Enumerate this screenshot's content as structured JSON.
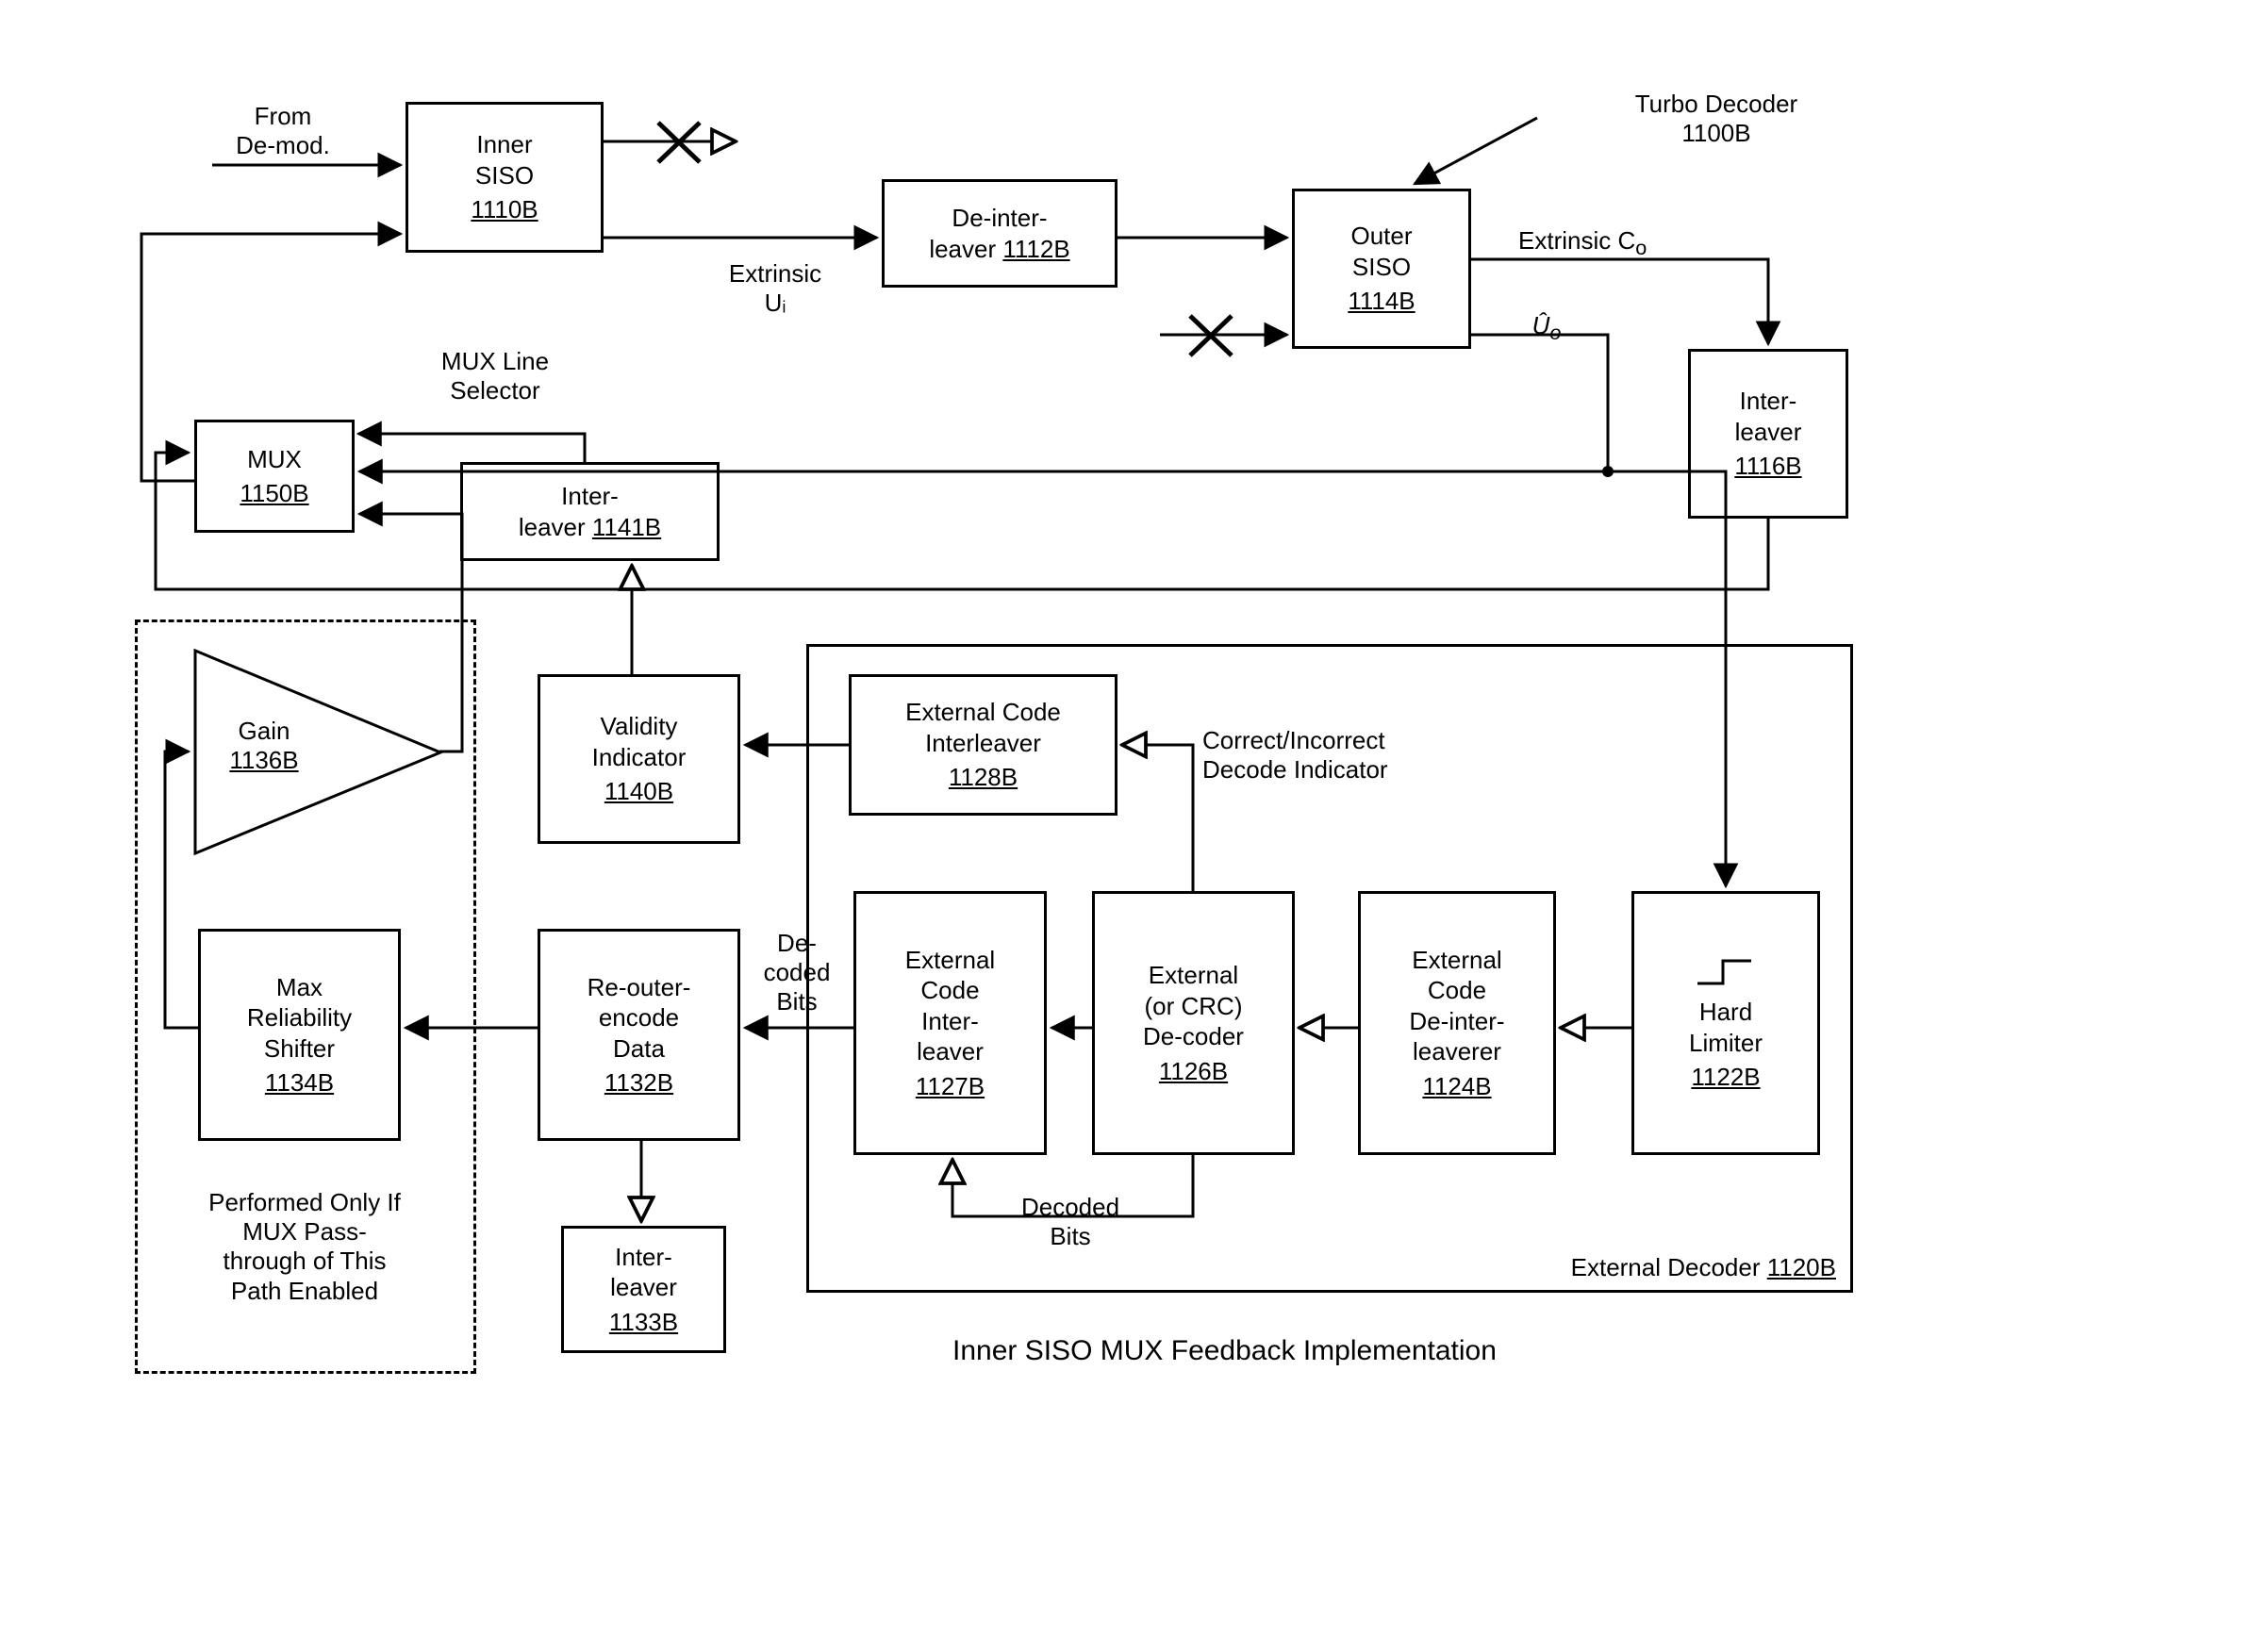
{
  "input_label": "From\nDe-mod.",
  "turbo": {
    "title": "Turbo Decoder",
    "ref": "1100B"
  },
  "inner_siso": {
    "title": "Inner\nSISO",
    "ref": "1110B"
  },
  "extrinsic_u": "Extrinsic\nUᵢ",
  "deinter": {
    "title": "De-inter-\nleaver ",
    "ref": "1112B"
  },
  "outer_siso": {
    "title": "Outer\nSISO",
    "ref": "1114B"
  },
  "extrinsic_c": "Extrinsic C",
  "extrinsic_c_sub": "o",
  "u_hat": "Û",
  "u_hat_sub": "o",
  "inter_1116": {
    "title": "Inter-\nleaver",
    "ref": "1116B"
  },
  "mux_selector": "MUX Line\nSelector",
  "mux": {
    "title": "MUX",
    "ref": "1150B"
  },
  "inter_1141": {
    "title": "Inter-\nleaver ",
    "ref": "1141B"
  },
  "validity": {
    "title": "Validity\nIndicator",
    "ref": "1140B"
  },
  "ext_inter_1128": {
    "title": "External Code\nInterleaver",
    "ref": "1128B"
  },
  "cidi": "Correct/Incorrect\nDecode Indicator",
  "gain": {
    "title": "Gain",
    "ref": "1136B"
  },
  "max_rel": {
    "title": "Max\nReliability\nShifter",
    "ref": "1134B"
  },
  "reoe": {
    "title": "Re-outer-\nencode\nData",
    "ref": "1132B"
  },
  "dec_bits_label": "De-\ncoded\nBits",
  "ext_inter_1127": {
    "title": "External\nCode\nInter-\nleaver",
    "ref": "1127B"
  },
  "ext_dec_1126": {
    "title": "External\n(or CRC)\nDe-coder",
    "ref": "1126B"
  },
  "ext_deinter_1124": {
    "title": "External\nCode\nDe-inter-\nleaverer",
    "ref": "1124B"
  },
  "hard_lim": {
    "title": "Hard\nLimiter",
    "ref": "1122B"
  },
  "inter_1133": {
    "title": "Inter-\nleaver",
    "ref": "1133B"
  },
  "decoded_bits": "Decoded\nBits",
  "ext_decoder": {
    "title": "External Decoder ",
    "ref": "1120B"
  },
  "dashed_caption": "Performed Only If\nMUX Pass-\nthrough of This\nPath Enabled",
  "footer": "Inner SISO MUX Feedback Implementation"
}
